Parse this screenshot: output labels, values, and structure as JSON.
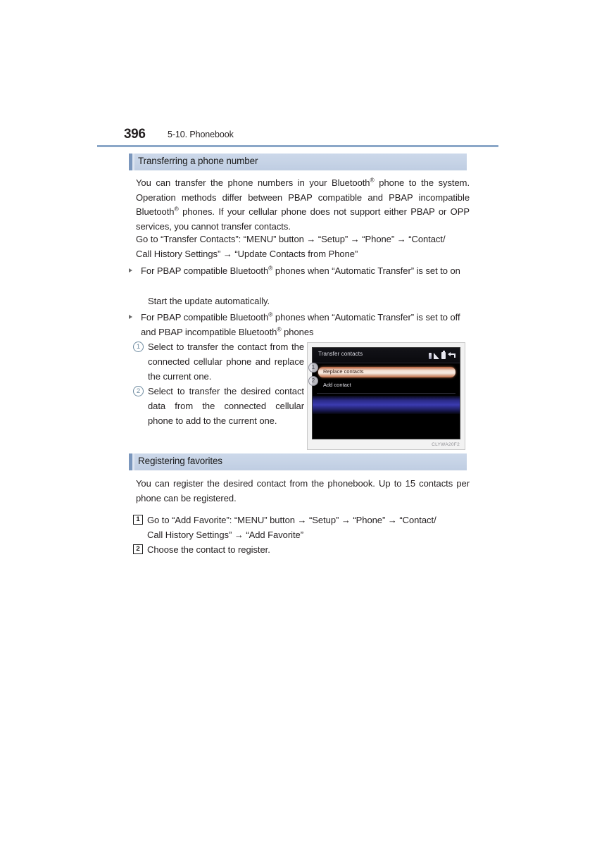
{
  "page": {
    "number": "396",
    "section": "5-10. Phonebook",
    "rule_color": "#8ba7c8"
  },
  "sections": [
    {
      "id": "transferring",
      "header": "Transferring a phone number",
      "paragraphs": [
        "You can transfer the phone numbers in your Bluetooth® phone to the system. Operation methods differ between PBAP compatible and PBAP incompatible Bluetooth® phones. If your cellular phone does not support either PBAP or OPP services, you cannot transfer contacts.",
        "Go to \"Transfer Contacts\": \"MENU\" button → \"Setup\" → \"Phone\" → \"Contact/Call History Settings\" → \"Update Contacts from Phone\""
      ],
      "bullets": [
        "For PBAP compatible Bluetooth® phones when \"Automatic Transfer\" is set to on",
        "For PBAP compatible Bluetooth® phones when \"Automatic Transfer\" is set to off and PBAP incompatible Bluetooth® phones"
      ],
      "sub_line": "Start the update automatically.",
      "numbered": [
        {
          "marker": "1",
          "text": "Select to transfer the contact from the connected cellular phone and replace the current one."
        },
        {
          "marker": "2",
          "text": "Select to transfer the desired contact data from the connected cellular phone to add to the current one."
        }
      ]
    },
    {
      "id": "registering-favorites",
      "header": "Registering favorites",
      "intro": "You can register the desired contact from the phonebook. Up to 15 contacts per phone can be registered.",
      "steps": [
        {
          "marker": "1",
          "text": "Go to \"Add Favorite\": \"MENU\" button → \"Setup\" → \"Phone\" → \"Contact/Call History Settings\" → \"Add Favorite\""
        },
        {
          "marker": "2",
          "text": "Choose the contact to register."
        }
      ]
    }
  ],
  "figure": {
    "caption": "CLYWA20F2",
    "device": {
      "title": "Transfer contacts",
      "status_icons": [
        "bluetooth-icon",
        "signal-icon",
        "battery-icon",
        "back-arrow-icon"
      ],
      "rows": [
        {
          "label": "Replace contacts",
          "selected": true,
          "callout": "1"
        },
        {
          "label": "Add contact",
          "selected": false,
          "callout": "2"
        }
      ]
    }
  }
}
